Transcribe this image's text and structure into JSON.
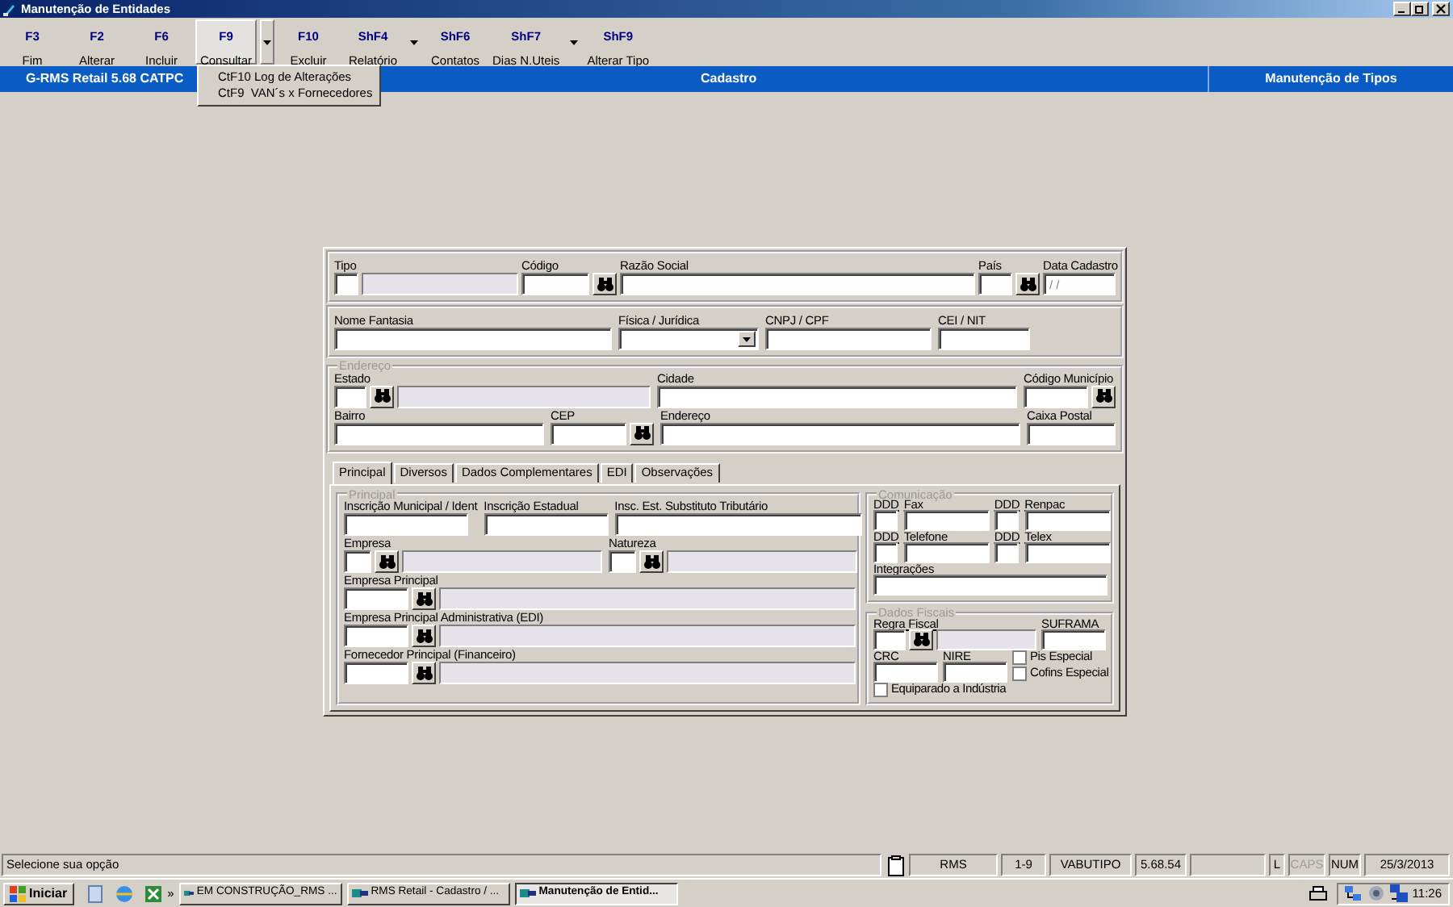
{
  "window": {
    "title": "Manutenção de Entidades"
  },
  "toolbar": [
    {
      "key": "F3",
      "label": "Fim",
      "pressed": false,
      "dropdown": false
    },
    {
      "key": "F2",
      "label": "Alterar",
      "pressed": false,
      "dropdown": false
    },
    {
      "key": "F6",
      "label": "Incluir",
      "pressed": false,
      "dropdown": false
    },
    {
      "key": "F9",
      "label": "Consultar",
      "pressed": true,
      "dropdown": true
    },
    {
      "key": "F10",
      "label": "Excluir",
      "pressed": false,
      "dropdown": false
    },
    {
      "key": "ShF4",
      "label": "Relatório",
      "pressed": false,
      "dropdown": true
    },
    {
      "key": "ShF6",
      "label": "Contatos",
      "pressed": false,
      "dropdown": false
    },
    {
      "key": "ShF7",
      "label": "Dias N.Uteis",
      "pressed": false,
      "dropdown": true
    },
    {
      "key": "ShF9",
      "label": "Alterar Tipo",
      "pressed": false,
      "dropdown": false
    }
  ],
  "menu": [
    "CtF10 Log de Alterações",
    "CtF9  VAN´s x Fornecedores"
  ],
  "header_bar": {
    "left": "G-RMS Retail 5.68 CATPC",
    "center": "Cadastro",
    "right": "Manutenção de Tipos"
  },
  "form": {
    "sections": [
      {
        "kind": "box",
        "rows": [
          {
            "fields": [
              {
                "kind": "field",
                "label": "Tipo",
                "parts": [
                  {
                    "kind": "input"
                  },
                  {
                    "kind": "display"
                  }
                ]
              },
              {
                "kind": "field",
                "label": "Código",
                "parts": [
                  {
                    "kind": "input"
                  },
                  {
                    "kind": "lookup"
                  }
                ]
              },
              {
                "kind": "field",
                "label": "Razão Social",
                "parts": [
                  {
                    "kind": "input"
                  }
                ]
              },
              {
                "kind": "field",
                "label": "País",
                "parts": [
                  {
                    "kind": "input"
                  },
                  {
                    "kind": "lookup"
                  }
                ]
              },
              {
                "kind": "field",
                "label": "Data Cadastro",
                "parts": [
                  {
                    "kind": "input",
                    "value": "/ /"
                  }
                ]
              }
            ]
          }
        ]
      },
      {
        "kind": "box",
        "rows": [
          {
            "fields": [
              {
                "kind": "field",
                "label": "Nome Fantasia",
                "parts": [
                  {
                    "kind": "input"
                  }
                ]
              },
              {
                "kind": "field",
                "label": "Física / Jurídica",
                "parts": [
                  {
                    "kind": "select"
                  }
                ]
              },
              {
                "kind": "field",
                "label": "CNPJ / CPF",
                "parts": [
                  {
                    "kind": "input"
                  }
                ]
              },
              {
                "kind": "field",
                "label": "CEI / NIT",
                "parts": [
                  {
                    "kind": "input"
                  }
                ]
              }
            ]
          }
        ]
      },
      {
        "kind": "fieldset",
        "legend": "Endereço",
        "rows": [
          {
            "fields": [
              {
                "kind": "field",
                "label": "Estado",
                "parts": [
                  {
                    "kind": "input"
                  },
                  {
                    "kind": "lookup"
                  },
                  {
                    "kind": "display"
                  }
                ]
              },
              {
                "kind": "field",
                "label": "Cidade",
                "parts": [
                  {
                    "kind": "input"
                  }
                ]
              },
              {
                "kind": "field",
                "label": "Código Município",
                "parts": [
                  {
                    "kind": "input"
                  },
                  {
                    "kind": "lookup"
                  }
                ]
              }
            ]
          },
          {
            "fields": [
              {
                "kind": "field",
                "label": "Bairro",
                "parts": [
                  {
                    "kind": "input"
                  }
                ]
              },
              {
                "kind": "field",
                "label": "CEP",
                "parts": [
                  {
                    "kind": "input"
                  },
                  {
                    "kind": "lookup"
                  }
                ]
              },
              {
                "kind": "field",
                "label": "Endereço",
                "parts": [
                  {
                    "kind": "input"
                  }
                ]
              },
              {
                "kind": "field",
                "label": "Caixa Postal",
                "parts": [
                  {
                    "kind": "input"
                  }
                ]
              }
            ]
          }
        ]
      }
    ],
    "tabs": [
      {
        "label": "Principal",
        "selected": true
      },
      {
        "label": "Diversos",
        "selected": false
      },
      {
        "label": "Dados Complementares",
        "selected": false
      },
      {
        "label": "EDI",
        "selected": false
      },
      {
        "label": "Observações",
        "selected": false
      }
    ],
    "tab_panel": {
      "left": {
        "legend": "Principal",
        "rows": [
          {
            "fields": [
              {
                "kind": "field",
                "label": "Inscrição Municipal / Ident",
                "parts": [
                  {
                    "kind": "input"
                  }
                ]
              },
              {
                "kind": "field",
                "label": "Inscrição Estadual",
                "parts": [
                  {
                    "kind": "input"
                  }
                ]
              },
              {
                "kind": "field",
                "label": "Insc. Est. Substituto Tributário",
                "parts": [
                  {
                    "kind": "input"
                  }
                ]
              }
            ]
          },
          {
            "fields": [
              {
                "kind": "field",
                "label": "Empresa",
                "parts": [
                  {
                    "kind": "input"
                  },
                  {
                    "kind": "lookup"
                  },
                  {
                    "kind": "display"
                  }
                ]
              },
              {
                "kind": "field",
                "label": "Natureza",
                "parts": [
                  {
                    "kind": "input"
                  },
                  {
                    "kind": "lookup"
                  },
                  {
                    "kind": "display"
                  }
                ]
              }
            ]
          },
          {
            "fields": [
              {
                "kind": "field",
                "label": "Empresa Principal",
                "parts": [
                  {
                    "kind": "input"
                  },
                  {
                    "kind": "lookup"
                  },
                  {
                    "kind": "display"
                  }
                ]
              }
            ]
          },
          {
            "fields": [
              {
                "kind": "field",
                "label": "Empresa Principal Administrativa (EDI)",
                "parts": [
                  {
                    "kind": "input"
                  },
                  {
                    "kind": "lookup"
                  },
                  {
                    "kind": "display"
                  }
                ]
              }
            ]
          },
          {
            "fields": [
              {
                "kind": "field",
                "label": "Fornecedor Principal (Financeiro)",
                "parts": [
                  {
                    "kind": "input"
                  },
                  {
                    "kind": "lookup"
                  },
                  {
                    "kind": "display"
                  }
                ]
              }
            ]
          }
        ]
      },
      "right": [
        {
          "legend": "Comunicação",
          "rows": [
            {
              "fields": [
                {
                  "kind": "field",
                  "label": "DDD",
                  "parts": [
                    {
                      "kind": "input"
                    }
                  ]
                },
                {
                  "kind": "field",
                  "label": "Fax",
                  "parts": [
                    {
                      "kind": "input"
                    }
                  ]
                },
                {
                  "kind": "field",
                  "label": "DDD",
                  "parts": [
                    {
                      "kind": "input"
                    }
                  ]
                },
                {
                  "kind": "field",
                  "label": "Renpac",
                  "parts": [
                    {
                      "kind": "input"
                    }
                  ]
                }
              ]
            },
            {
              "fields": [
                {
                  "kind": "field",
                  "label": "DDD",
                  "parts": [
                    {
                      "kind": "input"
                    }
                  ]
                },
                {
                  "kind": "field",
                  "label": "Telefone",
                  "parts": [
                    {
                      "kind": "input"
                    }
                  ]
                },
                {
                  "kind": "field",
                  "label": "DDD",
                  "parts": [
                    {
                      "kind": "input"
                    }
                  ]
                },
                {
                  "kind": "field",
                  "label": "Telex",
                  "parts": [
                    {
                      "kind": "input"
                    }
                  ]
                }
              ]
            },
            {
              "fields": [
                {
                  "kind": "field",
                  "label": "Integrações",
                  "parts": [
                    {
                      "kind": "input"
                    }
                  ]
                }
              ]
            }
          ]
        },
        {
          "legend": "Dados Fiscais",
          "rows": [
            {
              "fields": [
                {
                  "kind": "field",
                  "label": "Regra Fiscal",
                  "parts": [
                    {
                      "kind": "input"
                    },
                    {
                      "kind": "lookup"
                    },
                    {
                      "kind": "display"
                    }
                  ]
                },
                {
                  "kind": "field",
                  "label": "SUFRAMA",
                  "parts": [
                    {
                      "kind": "input"
                    }
                  ]
                }
              ]
            },
            {
              "fields": [
                {
                  "kind": "field",
                  "label": "CRC",
                  "parts": [
                    {
                      "kind": "input"
                    }
                  ]
                },
                {
                  "kind": "field",
                  "label": "NIRE",
                  "parts": [
                    {
                      "kind": "input"
                    }
                  ]
                },
                {
                  "kind": "checks",
                  "items": [
                    {
                      "label": "Pis Especial",
                      "checked": false
                    },
                    {
                      "label": "Cofins Especial",
                      "checked": false
                    }
                  ]
                }
              ]
            },
            {
              "fields": [
                {
                  "kind": "checks",
                  "items": [
                    {
                      "label": "Equiparado a Indústria",
                      "checked": false
                    }
                  ]
                }
              ]
            }
          ]
        }
      ]
    }
  },
  "status_bar": {
    "message": "Selecione sua opção",
    "panels": [
      {
        "kind": "icon"
      },
      {
        "kind": "text",
        "text": "RMS",
        "disabled": false
      },
      {
        "kind": "text",
        "text": "1-9",
        "disabled": false
      },
      {
        "kind": "text",
        "text": "VABUTIPO",
        "disabled": false
      },
      {
        "kind": "text",
        "text": "5.68.54",
        "disabled": false
      },
      {
        "kind": "empty"
      },
      {
        "kind": "text",
        "text": "L",
        "disabled": false
      },
      {
        "kind": "text",
        "text": "CAPS",
        "disabled": true
      },
      {
        "kind": "text",
        "text": "NUM",
        "disabled": false
      },
      {
        "kind": "text",
        "text": "25/3/2013",
        "disabled": false
      }
    ]
  },
  "taskbar": {
    "start": "Iniciar",
    "more": "»",
    "tasks": [
      {
        "label": "EM CONSTRUÇÃO_RMS ...",
        "selected": false
      },
      {
        "label": "RMS Retail - Cadastro / ...",
        "selected": false
      },
      {
        "label": "Manutenção de Entid...",
        "selected": true
      }
    ],
    "clock": "11:26"
  }
}
